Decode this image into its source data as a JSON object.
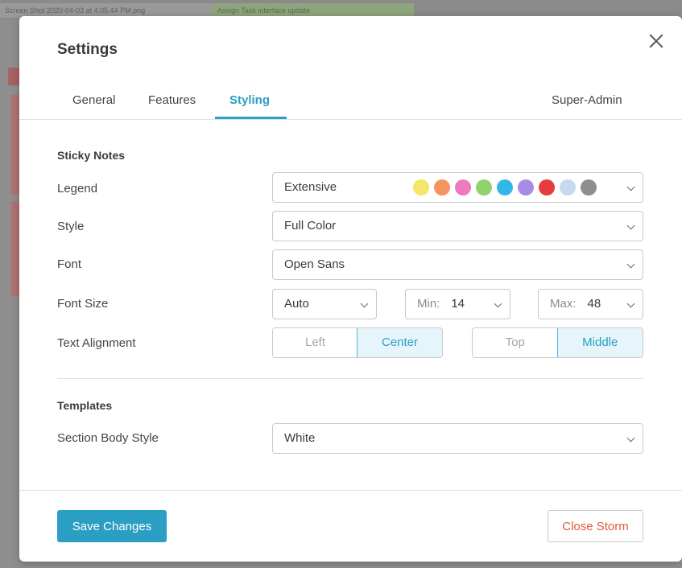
{
  "background": {
    "tab1_text": "Screen Shot 2020-04-03 at 4.05.44 PM.png",
    "tab2_text": "Assign Task interface update"
  },
  "dialog": {
    "title": "Settings",
    "tabs": [
      {
        "label": "General"
      },
      {
        "label": "Features"
      },
      {
        "label": "Styling"
      },
      {
        "label": "Super-Admin"
      }
    ],
    "active_tab": "Styling"
  },
  "sticky_notes": {
    "heading": "Sticky Notes",
    "legend_label": "Legend",
    "legend_value": "Extensive",
    "legend_colors": [
      "#f5e56b",
      "#f69461",
      "#ee7bbf",
      "#8fd36a",
      "#35b6e9",
      "#a98be6",
      "#e63b3b",
      "#c8d8ef",
      "#8e8e8e"
    ],
    "style_label": "Style",
    "style_value": "Full Color",
    "font_label": "Font",
    "font_value": "Open Sans",
    "font_size_label": "Font Size",
    "font_size_value": "Auto",
    "min_label": "Min:",
    "min_value": "14",
    "max_label": "Max:",
    "max_value": "48",
    "text_alignment_label": "Text Alignment",
    "h_align_options": [
      "Left",
      "Center"
    ],
    "h_align_selected": "Center",
    "v_align_options": [
      "Top",
      "Middle"
    ],
    "v_align_selected": "Middle"
  },
  "templates": {
    "heading": "Templates",
    "section_body_style_label": "Section Body Style",
    "section_body_style_value": "White"
  },
  "footer": {
    "save_label": "Save Changes",
    "close_label": "Close Storm"
  },
  "colors": {
    "accent": "#2a9ec3",
    "danger": "#e05a3e"
  }
}
